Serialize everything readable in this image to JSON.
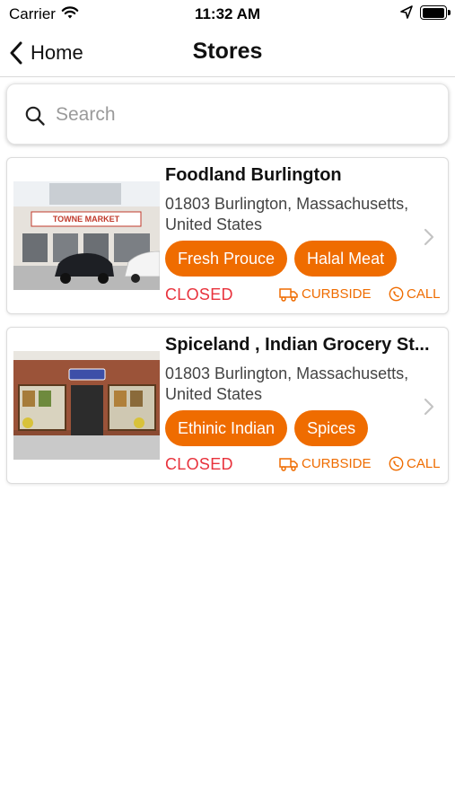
{
  "status_bar": {
    "carrier": "Carrier",
    "time": "11:32 AM"
  },
  "nav": {
    "back_label": "Home",
    "title": "Stores"
  },
  "search": {
    "placeholder": "Search",
    "value": ""
  },
  "stores": [
    {
      "name": "Foodland Burlington",
      "address": "01803 Burlington, Massachusetts, United States",
      "tags": [
        "Fresh Prouce",
        "Halal Meat"
      ],
      "status": "CLOSED",
      "curbside_label": "CURBSIDE",
      "call_label": "CALL",
      "photo_sign_text": "TOWNE MARKET"
    },
    {
      "name": "Spiceland , Indian Grocery St...",
      "address": "01803 Burlington, Massachusetts, United States",
      "tags": [
        "Ethinic Indian",
        "Spices"
      ],
      "status": "CLOSED",
      "curbside_label": "CURBSIDE",
      "call_label": "CALL"
    }
  ],
  "colors": {
    "accent": "#ef6c00",
    "closed": "#e8323c",
    "text": "#111111",
    "secondary_text": "#444444"
  }
}
